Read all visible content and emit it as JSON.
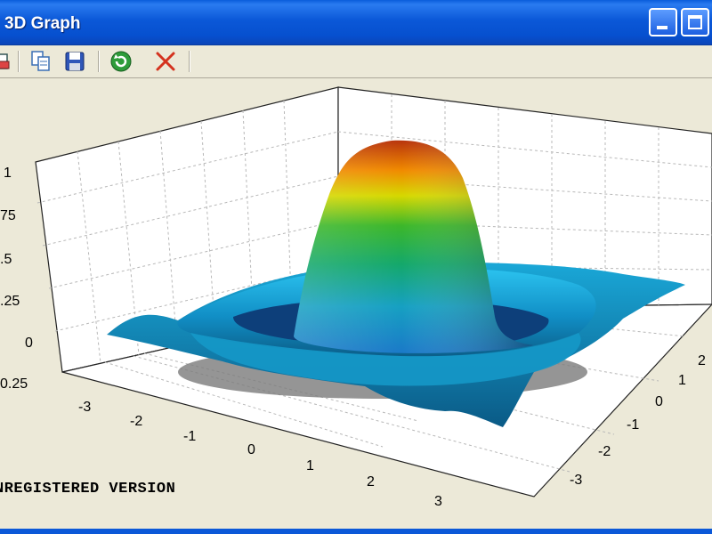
{
  "window": {
    "title": "3D Graph"
  },
  "toolbar": {
    "buttons": [
      {
        "name": "print-icon"
      },
      {
        "name": "copy-icon"
      },
      {
        "name": "save-icon"
      },
      {
        "name": "refresh-icon"
      },
      {
        "name": "close-graph-icon"
      }
    ]
  },
  "watermark": "NREGISTERED VERSION",
  "chart_data": {
    "type": "surface3d",
    "function": "sinc-like radial surface",
    "z_ticks": [
      "1",
      "75",
      ".5",
      ".25",
      "0",
      "0.25"
    ],
    "x_ticks": [
      "-3",
      "-2",
      "-1",
      "0",
      "1",
      "2",
      "3"
    ],
    "y_ticks": [
      "2",
      "1",
      "0",
      "-1",
      "-2",
      "-3"
    ],
    "xlim": [
      -3.5,
      3.5
    ],
    "ylim": [
      -3.5,
      3.5
    ],
    "zlim": [
      -0.25,
      1
    ],
    "grid": true,
    "colormap": [
      "#1a6fd0",
      "#1fb3e8",
      "#19c98a",
      "#3fbf2a",
      "#e0e000",
      "#ff9a00",
      "#c0280f"
    ]
  }
}
